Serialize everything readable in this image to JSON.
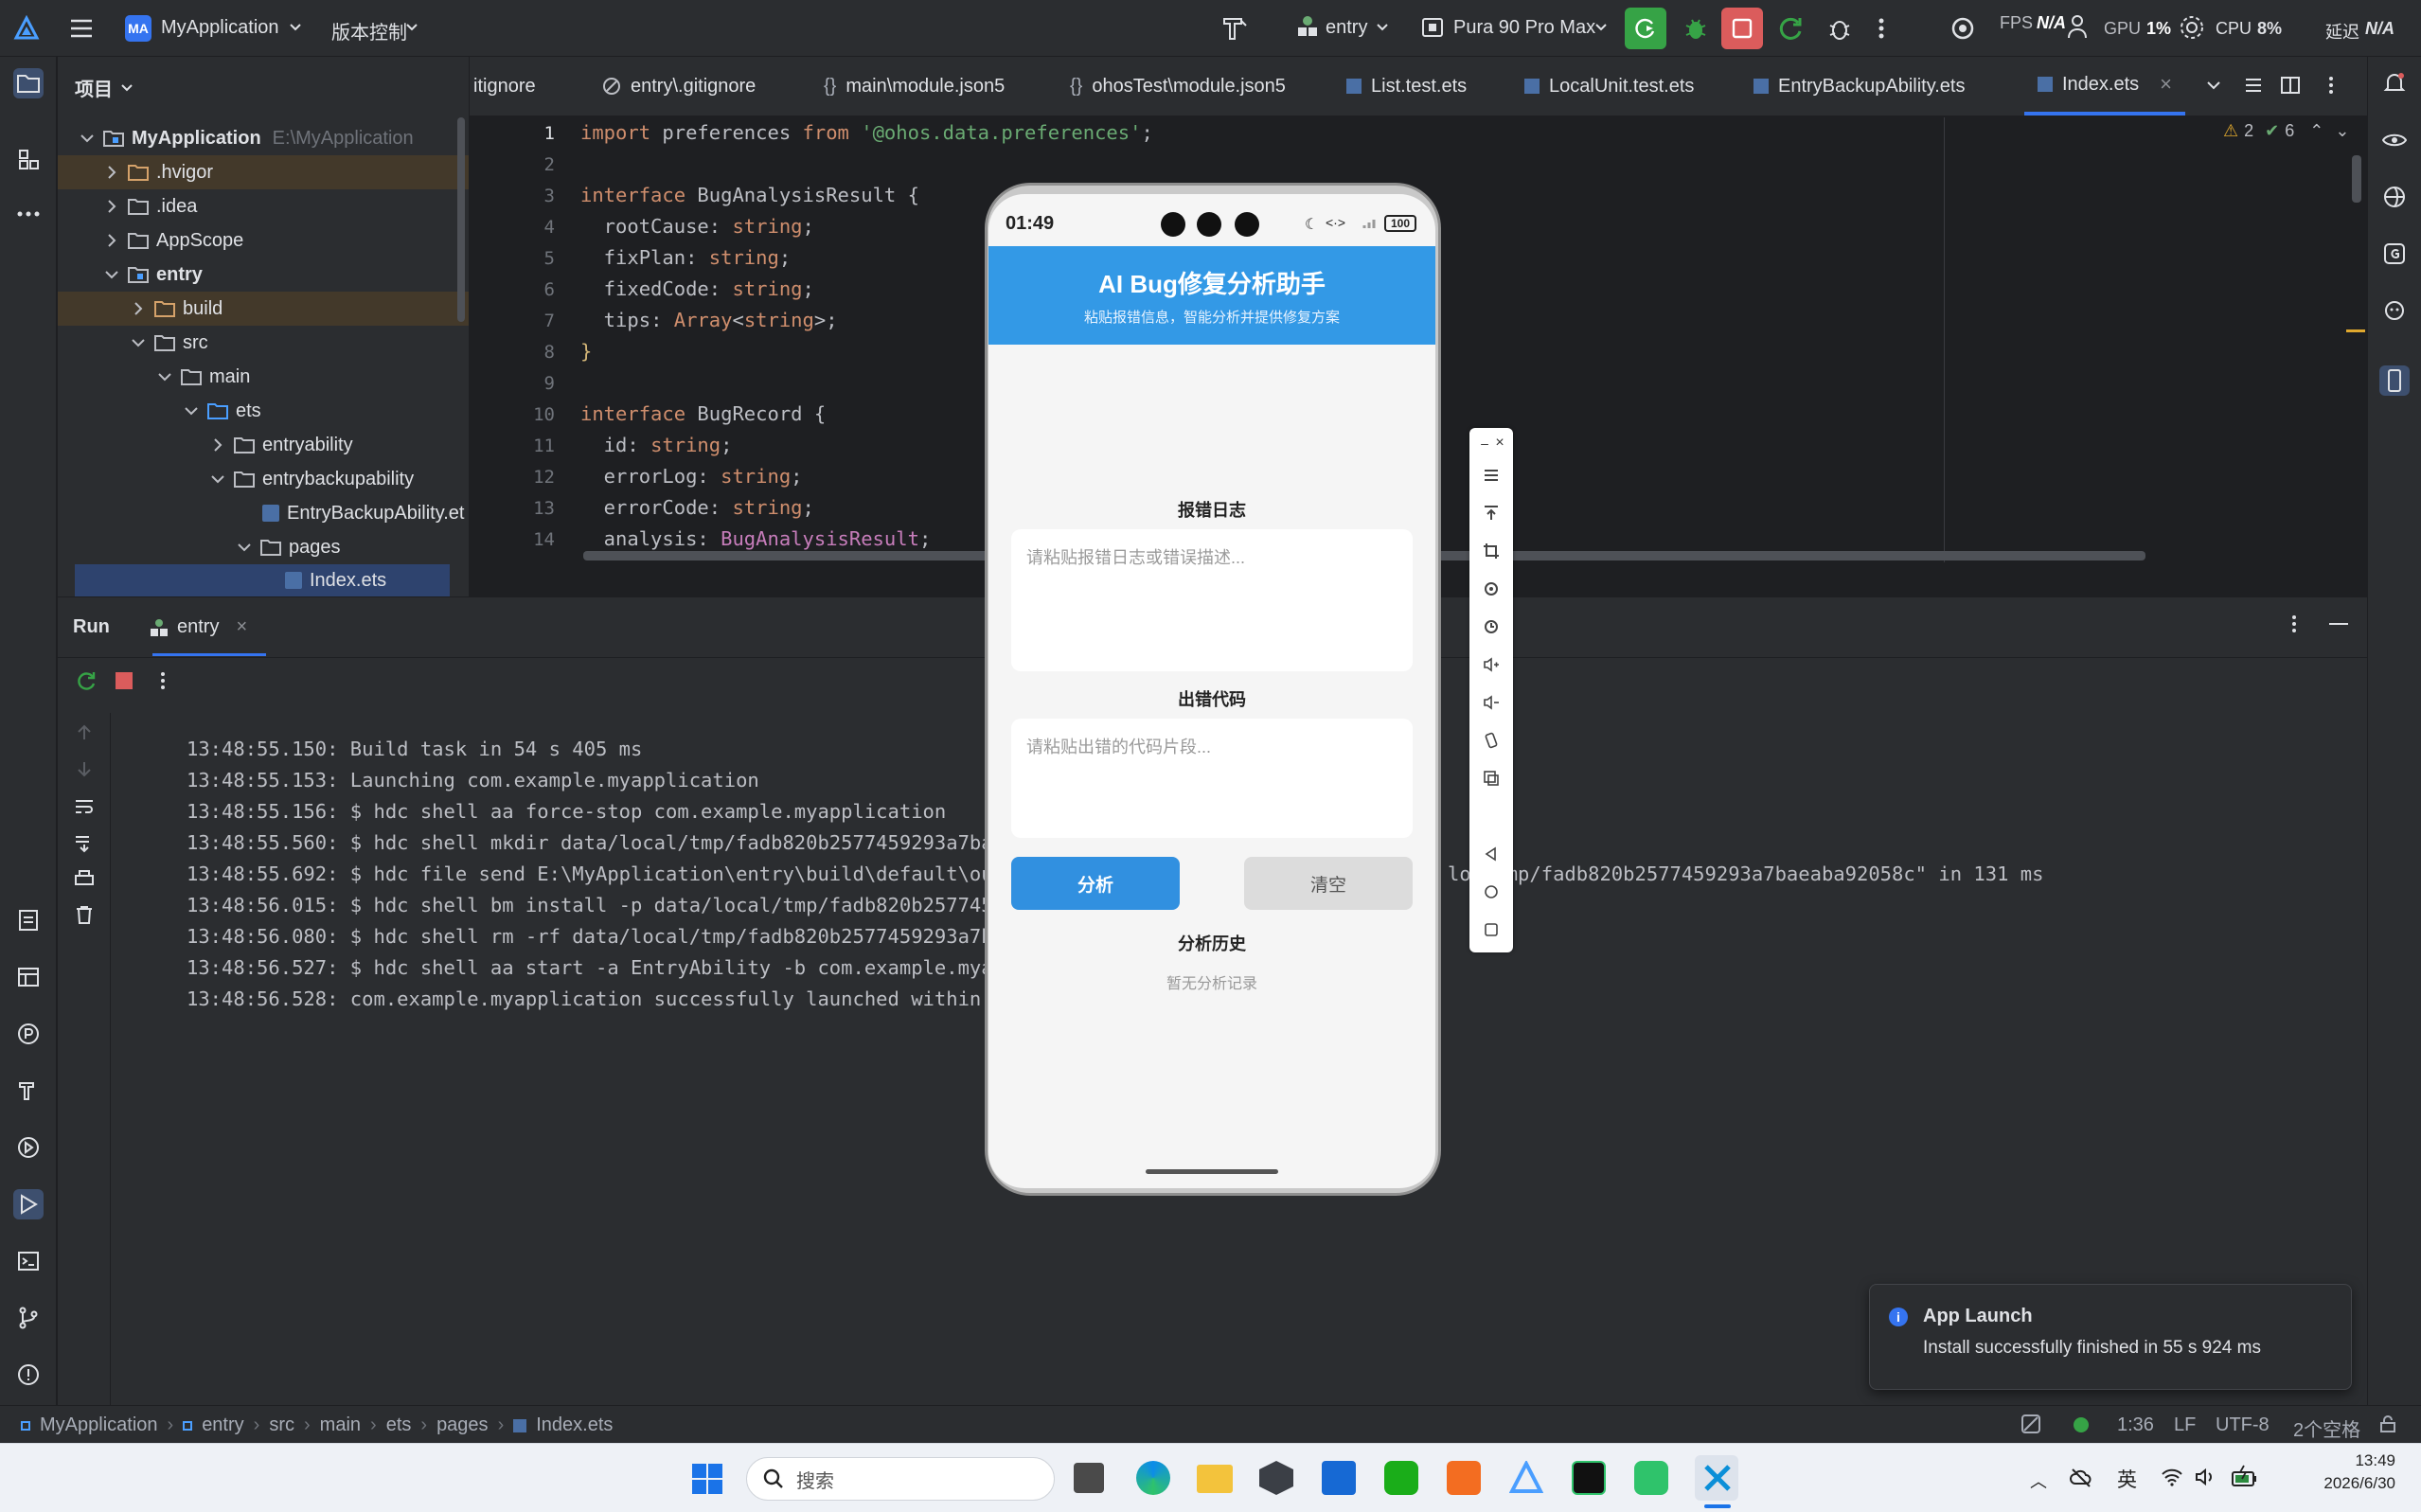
{
  "titlebar": {
    "app_badge": "MA",
    "project_name": "MyApplication",
    "vcs_menu": "版本控制",
    "run_config": "entry",
    "device": "Pura 90 Pro Max",
    "metrics": {
      "fps_label": "FPS",
      "fps_value": "N/A",
      "gpu_label": "GPU",
      "gpu_value": "1%",
      "cpu_label": "CPU",
      "cpu_value": "8%",
      "latency_label": "延迟",
      "latency_value": "N/A"
    }
  },
  "project_panel": {
    "title": "项目",
    "root_name": "MyApplication",
    "root_path": "E:\\MyApplication",
    "items": [
      {
        "label": ".hvigor"
      },
      {
        "label": ".idea"
      },
      {
        "label": "AppScope"
      },
      {
        "label": "entry"
      },
      {
        "label": "build"
      },
      {
        "label": "src"
      },
      {
        "label": "main"
      },
      {
        "label": "ets"
      },
      {
        "label": "entryability"
      },
      {
        "label": "entrybackupability"
      },
      {
        "label": "EntryBackupAbility.et"
      },
      {
        "label": "pages"
      },
      {
        "label": "Index.ets"
      }
    ]
  },
  "tabs": [
    {
      "label": "itignore"
    },
    {
      "label": "entry\\.gitignore"
    },
    {
      "label": "main\\module.json5"
    },
    {
      "label": "ohosTest\\module.json5"
    },
    {
      "label": "List.test.ets"
    },
    {
      "label": "LocalUnit.test.ets"
    },
    {
      "label": "EntryBackupAbility.ets"
    },
    {
      "label": "Index.ets"
    }
  ],
  "inspections": {
    "warnings": "2",
    "ok": "6"
  },
  "code_lines": {
    "n": [
      "1",
      "2",
      "3",
      "4",
      "5",
      "6",
      "7",
      "8",
      "9",
      "10",
      "11",
      "12",
      "13",
      "14"
    ],
    "l1a": "import",
    "l1b": " preferences ",
    "l1c": "from",
    "l1d": " '@ohos.data.preferences'",
    "l1e": ";",
    "l3a": "interface",
    "l3b": " BugAnalysisResult {",
    "l4a": "  rootCause",
    "l4b": ": ",
    "l4c": "string",
    "l4d": ";",
    "l5a": "  fixPlan",
    "l5b": ": ",
    "l5c": "string",
    "l5d": ";",
    "l6a": "  fixedCode",
    "l6b": ": ",
    "l6c": "string",
    "l6d": ";",
    "l7a": "  tips",
    "l7b": ": ",
    "l7c": "Array",
    "l7d": "<",
    "l7e": "string",
    "l7f": ">;",
    "l8": "}",
    "l10a": "interface",
    "l10b": " BugRecord {",
    "l11a": "  id",
    "l11b": ": ",
    "l11c": "string",
    "l11d": ";",
    "l12a": "  errorLog",
    "l12b": ": ",
    "l12c": "string",
    "l12d": ";",
    "l13a": "  errorCode",
    "l13b": ": ",
    "l13c": "string",
    "l13d": ";",
    "l14a": "  analysis",
    "l14b": ": ",
    "l14c": "BugAnalysisResult",
    "l14d": ";"
  },
  "run_panel": {
    "title": "Run",
    "tab": "entry",
    "log": [
      "13:48:55.150: Build task in 54 s 405 ms",
      "13:48:55.153: Launching com.example.myapplication",
      "13:48:55.156: $ hdc shell aa force-stop com.example.myapplication",
      "13:48:55.560: $ hdc shell mkdir data/local/tmp/fadb820b2577459293a7baeaba92",
      "13:48:55.692: $ hdc file send E:\\MyApplication\\entry\\build\\default\\outputs\\",
      "13:48:56.015: $ hdc shell bm install -p data/local/tmp/fadb820b2577459293a7",
      "13:48:56.080: $ hdc shell rm -rf data/local/tmp/fadb820b2577459293a7baeaba9",
      "13:48:56.527: $ hdc shell aa start -a EntryAbility -b com.example.myapplica",
      "13:48:56.528: com.example.myapplication successfully launched within 1 s 37"
    ],
    "log_tail": "lo  tmp/fadb820b2577459293a7baeaba92058c\" in 131 ms"
  },
  "notification": {
    "title": "App Launch",
    "body": "Install successfully finished in 55 s 924 ms"
  },
  "statusbar": {
    "crumbs": [
      "MyApplication",
      "entry",
      "src",
      "main",
      "ets",
      "pages",
      "Index.ets"
    ],
    "position": "1:36",
    "line_sep": "LF",
    "encoding": "UTF-8",
    "indent": "2个空格"
  },
  "phone": {
    "time": "01:49",
    "battery": "100",
    "app_title": "AI Bug修复分析助手",
    "app_subtitle": "粘贴报错信息，智能分析并提供修复方案",
    "log_label": "报错日志",
    "log_placeholder": "请粘贴报错日志或错误描述...",
    "code_label": "出错代码",
    "code_placeholder": "请粘贴出错的代码片段...",
    "analyze_button": "分析",
    "clear_button": "清空",
    "history_label": "分析历史",
    "history_empty": "暂无分析记录"
  },
  "taskbar": {
    "search_placeholder": "搜索",
    "ime": "英",
    "clock_time": "13:49",
    "clock_date": "2026/6/30"
  },
  "colors": {
    "accent": "#3574f0",
    "phone_header": "#3399e6",
    "analyze_btn": "#3190e0"
  }
}
